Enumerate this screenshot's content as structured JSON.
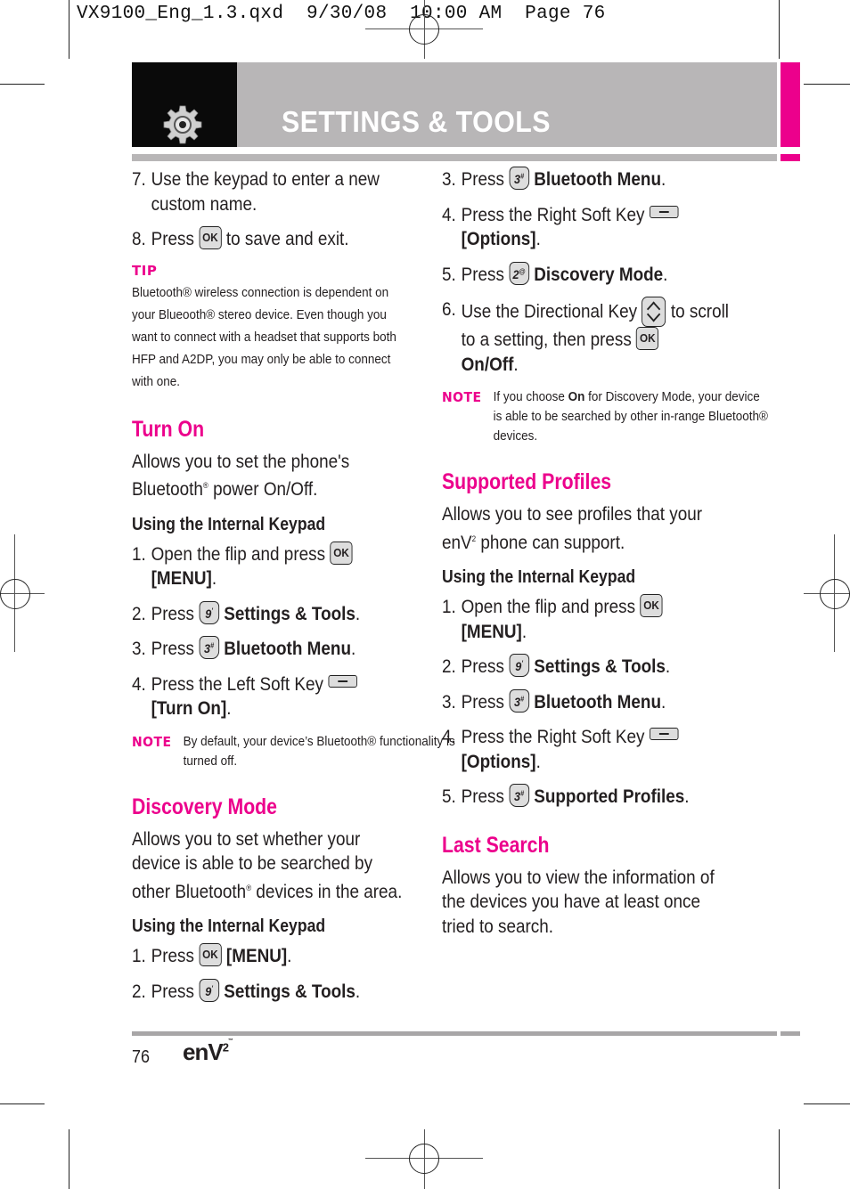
{
  "print_slug": "VX9100_Eng_1.3.qxd  9/30/08  10:00 AM  Page 76",
  "header": {
    "title": "SETTINGS & TOOLS",
    "icon": "gear-icon",
    "accent_color": "#ec008c",
    "band_color": "#b8b6b7"
  },
  "left": {
    "steps_top": [
      {
        "num": "7.",
        "text": "Use the keypad to enter a new custom name."
      },
      {
        "num": "8.",
        "pre": "Press",
        "key": "OK",
        "post": "to save and exit."
      }
    ],
    "tip": {
      "label": "TIP",
      "text": "Bluetooth® wireless connection is dependent on your Blueooth® stereo device. Even though you want to connect with a headset that supports both HFP and A2DP, you may only be able to connect with one."
    },
    "turn_on": {
      "heading": "Turn On",
      "desc_1": "Allows you to set the phone's Bluetooth",
      "desc_2": " power On/Off.",
      "subheading": "Using the Internal Keypad",
      "steps": [
        {
          "num": "1.",
          "pre": "Open the flip and press",
          "key": "OK",
          "bold": "[MENU]",
          "end": "."
        },
        {
          "num": "2.",
          "pre": "Press",
          "key": "9",
          "key_sup": "'",
          "bold": "Settings & Tools",
          "end": "."
        },
        {
          "num": "3.",
          "pre": "Press",
          "key": "3",
          "key_sup": "#",
          "bold": "Bluetooth Menu",
          "end": "."
        },
        {
          "num": "4.",
          "pre": "Press the Left Soft Key",
          "key": "soft-key",
          "bold": "[Turn On]",
          "end": "."
        }
      ],
      "note": {
        "label": "NOTE",
        "text": "By default, your device’s Bluetooth® functionality is turned off."
      }
    },
    "discovery": {
      "heading": "Discovery Mode",
      "desc_1": "Allows you to set whether your device is able to be searched by other Bluetooth",
      "desc_2": " devices in the area.",
      "subheading": "Using the Internal Keypad",
      "steps": [
        {
          "num": "1.",
          "pre": "Press",
          "key": "OK",
          "bold": "[MENU]",
          "end": "."
        },
        {
          "num": "2.",
          "pre": "Press",
          "key": "9",
          "key_sup": "'",
          "bold": "Settings & Tools",
          "end": "."
        }
      ]
    }
  },
  "right": {
    "discovery_cont": [
      {
        "num": "3.",
        "pre": "Press",
        "key": "3",
        "key_sup": "#",
        "bold": "Bluetooth Menu",
        "end": "."
      },
      {
        "num": "4.",
        "pre": "Press the Right Soft Key",
        "key": "soft-key",
        "bold": "[Options]",
        "end": "."
      },
      {
        "num": "5.",
        "pre": "Press",
        "key": "2",
        "key_sup": "@",
        "bold": "Discovery Mode",
        "end": "."
      },
      {
        "num": "6.",
        "pre": "Use the Directional Key",
        "key": "directional-key",
        "mid": "to scroll to a setting, then press",
        "key2": "OK",
        "bold": "On/Off",
        "end": "."
      }
    ],
    "discovery_note": {
      "label": "NOTE",
      "pre": "If you choose ",
      "bold": "On",
      "post": " for Discovery Mode, your device is able to be searched by other in-range Bluetooth® devices."
    },
    "profiles": {
      "heading": "Supported Profiles",
      "desc_1": "Allows you to see profiles that your enV",
      "desc_sup": "2",
      "desc_2": " phone can support.",
      "subheading": "Using the Internal Keypad",
      "steps": [
        {
          "num": "1.",
          "pre": "Open the flip and press",
          "key": "OK",
          "bold": "[MENU]",
          "end": "."
        },
        {
          "num": "2.",
          "pre": "Press",
          "key": "9",
          "key_sup": "'",
          "bold": "Settings & Tools",
          "end": "."
        },
        {
          "num": "3.",
          "pre": "Press",
          "key": "3",
          "key_sup": "#",
          "bold": "Bluetooth Menu",
          "end": "."
        },
        {
          "num": "4.",
          "pre": "Press the Right Soft Key",
          "key": "soft-key",
          "bold": "[Options]",
          "end": "."
        },
        {
          "num": "5.",
          "pre": "Press",
          "key": "3",
          "key_sup": "#",
          "bold": "Supported Profiles",
          "end": "."
        }
      ]
    },
    "last_search": {
      "heading": "Last Search",
      "desc": "Allows you to view the information of the devices you have at least once tried to search."
    }
  },
  "footer": {
    "page_number": "76",
    "logo": "enV",
    "logo_sup": "2",
    "logo_tm": "™"
  },
  "registered": "®"
}
